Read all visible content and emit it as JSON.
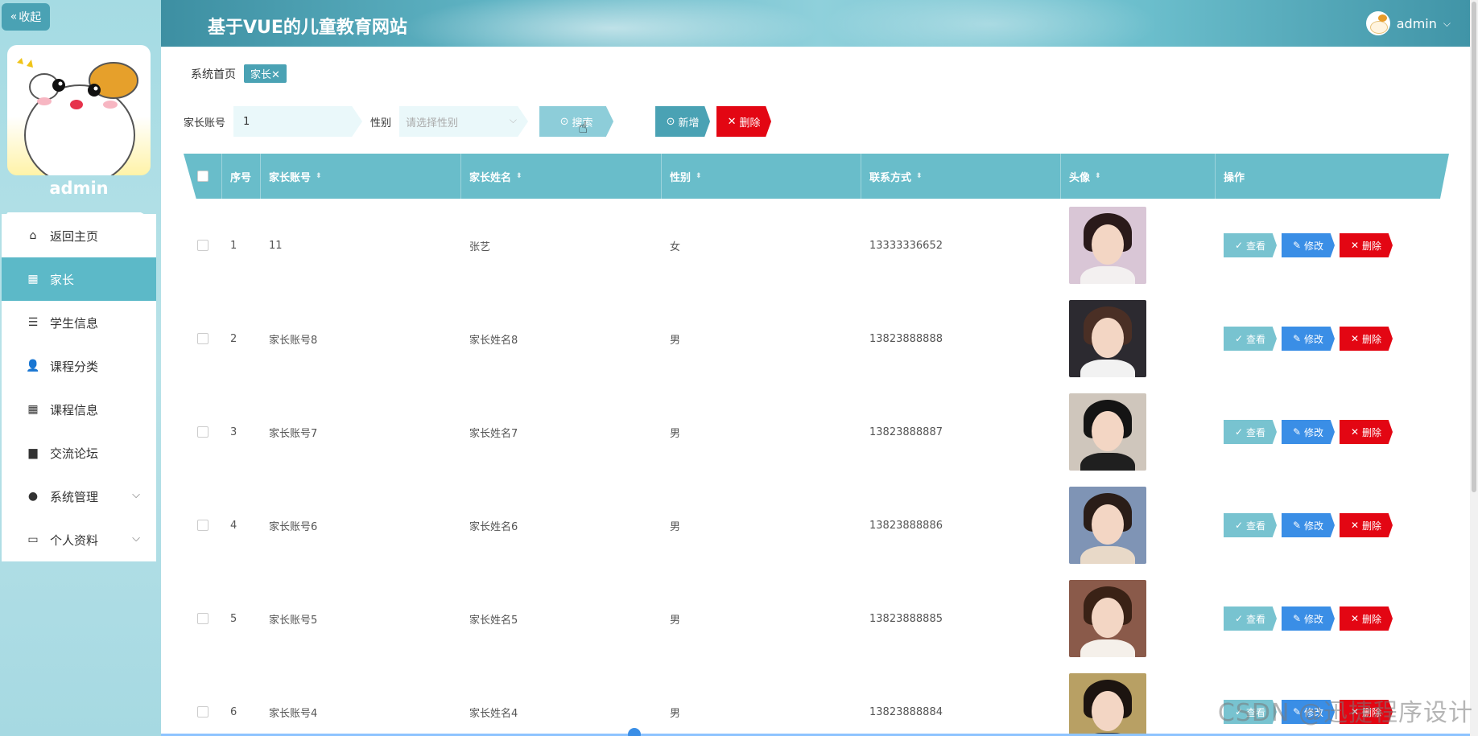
{
  "app": {
    "site_title": "基于VUE的儿童教育网站",
    "user": "admin",
    "collapse_label": "收起"
  },
  "sidebar": {
    "admin_name": "admin",
    "items": [
      {
        "label": "返回主页",
        "icon": "home-icon",
        "active": false
      },
      {
        "label": "家长",
        "icon": "grid-icon",
        "active": true
      },
      {
        "label": "学生信息",
        "icon": "list-icon",
        "active": false
      },
      {
        "label": "课程分类",
        "icon": "user-icon",
        "active": false
      },
      {
        "label": "课程信息",
        "icon": "grid-icon",
        "active": false
      },
      {
        "label": "交流论坛",
        "icon": "box-icon",
        "active": false
      },
      {
        "label": "系统管理",
        "icon": "bulb-icon",
        "active": false,
        "expandable": true
      },
      {
        "label": "个人资料",
        "icon": "card-icon",
        "active": false,
        "expandable": true
      }
    ]
  },
  "breadcrumb": {
    "home": "系统首页",
    "current_tag": "家长✕"
  },
  "search": {
    "account_label": "家长账号",
    "account_value": "1",
    "gender_label": "性别",
    "gender_placeholder": "请选择性别",
    "search_button": "搜索",
    "add_button": "新增",
    "delete_button": "删除"
  },
  "table": {
    "headers": [
      "序号",
      "家长账号",
      "家长姓名",
      "性别",
      "联系方式",
      "头像",
      "操作"
    ],
    "rows": [
      {
        "index": "1",
        "account": "11",
        "name": "张艺",
        "gender": "女",
        "phone": "13333336652"
      },
      {
        "index": "2",
        "account": "家长账号8",
        "name": "家长姓名8",
        "gender": "男",
        "phone": "13823888888"
      },
      {
        "index": "3",
        "account": "家长账号7",
        "name": "家长姓名7",
        "gender": "男",
        "phone": "13823888887"
      },
      {
        "index": "4",
        "account": "家长账号6",
        "name": "家长姓名6",
        "gender": "男",
        "phone": "13823888886"
      },
      {
        "index": "5",
        "account": "家长账号5",
        "name": "家长姓名5",
        "gender": "男",
        "phone": "13823888885"
      },
      {
        "index": "6",
        "account": "家长账号4",
        "name": "家长姓名4",
        "gender": "男",
        "phone": "13823888884"
      }
    ],
    "actions": {
      "view": "查看",
      "edit": "修改",
      "delete": "删除"
    }
  },
  "watermark": "CSDN @迅捷程序设计",
  "colors": {
    "accent": "#4aa2b4",
    "header_cell": "#69bdca",
    "danger": "#e30613",
    "edit": "#3a8ee6"
  }
}
